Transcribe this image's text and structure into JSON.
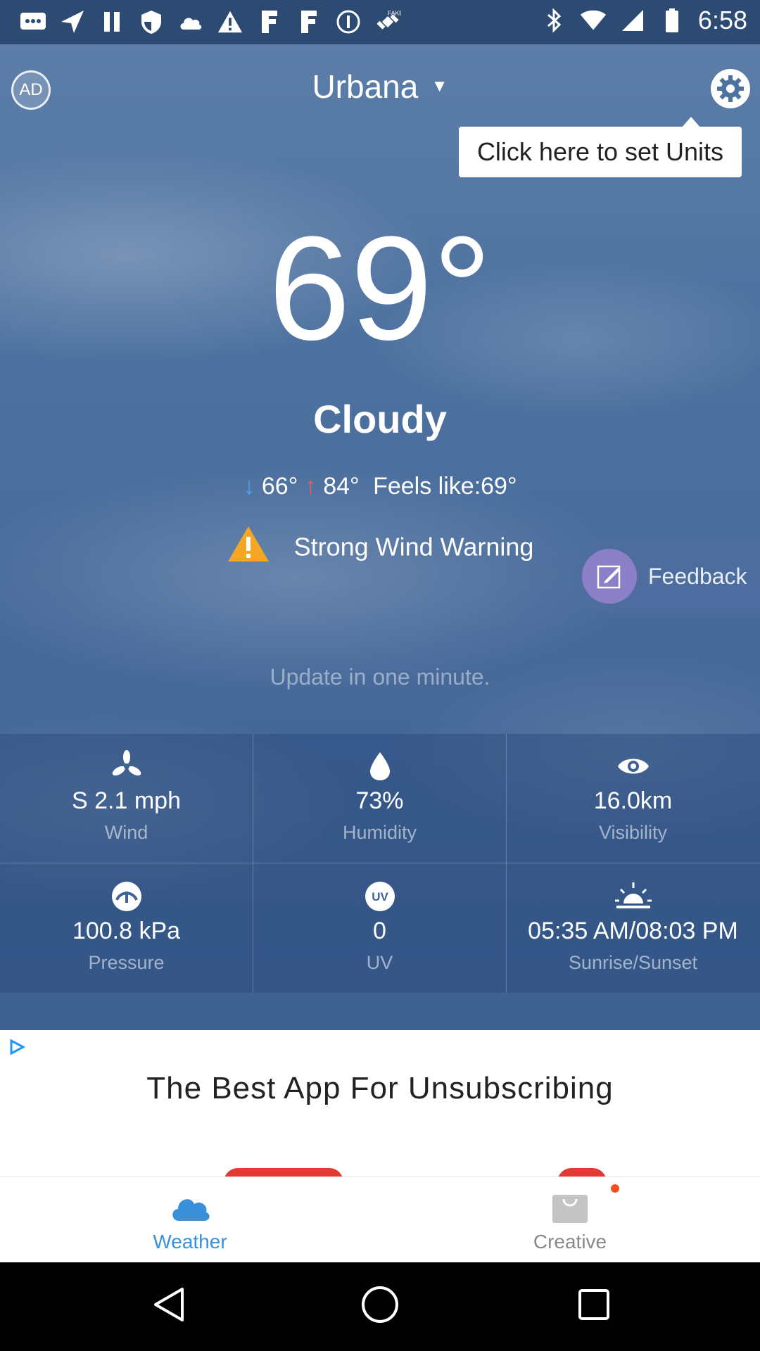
{
  "status_bar": {
    "time": "6:58",
    "icons": [
      "chat-icon",
      "send-icon",
      "pause-icon",
      "shield-icon",
      "cloud-icon",
      "alert-icon",
      "fitbit-icon",
      "fitbit-icon",
      "info-icon",
      "fake-gps-icon",
      "bluetooth-icon",
      "wifi-icon",
      "signal-icon",
      "battery-icon"
    ]
  },
  "header": {
    "ad_badge": "AD",
    "city": "Urbana",
    "units_tip": "Click here to set Units"
  },
  "current": {
    "temperature": "69°",
    "condition": "Cloudy",
    "low": "66°",
    "high": "84°",
    "feels_like": "Feels like:69°",
    "warning": "Strong Wind Warning",
    "update_note": "Update in one minute."
  },
  "feedback": {
    "label": "Feedback"
  },
  "details": [
    {
      "icon": "fan-icon",
      "value": "S 2.1 mph",
      "label": "Wind"
    },
    {
      "icon": "drop-icon",
      "value": "73%",
      "label": "Humidity"
    },
    {
      "icon": "eye-icon",
      "value": "16.0km",
      "label": "Visibility"
    },
    {
      "icon": "gauge-icon",
      "value": "100.8 kPa",
      "label": "Pressure"
    },
    {
      "icon": "uv-icon",
      "value": "0",
      "label": "UV"
    },
    {
      "icon": "sunrise-icon",
      "value": "05:35 AM/08:03 PM",
      "label": "Sunrise/Sunset"
    }
  ],
  "ad_banner": {
    "text": "The Best App For Unsubscribing"
  },
  "tabs": [
    {
      "label": "Weather",
      "active": true
    },
    {
      "label": "Creative",
      "active": false
    }
  ],
  "colors": {
    "accent": "#3a8fd9",
    "warning": "#f5a623",
    "sky": "#4e72a0"
  }
}
